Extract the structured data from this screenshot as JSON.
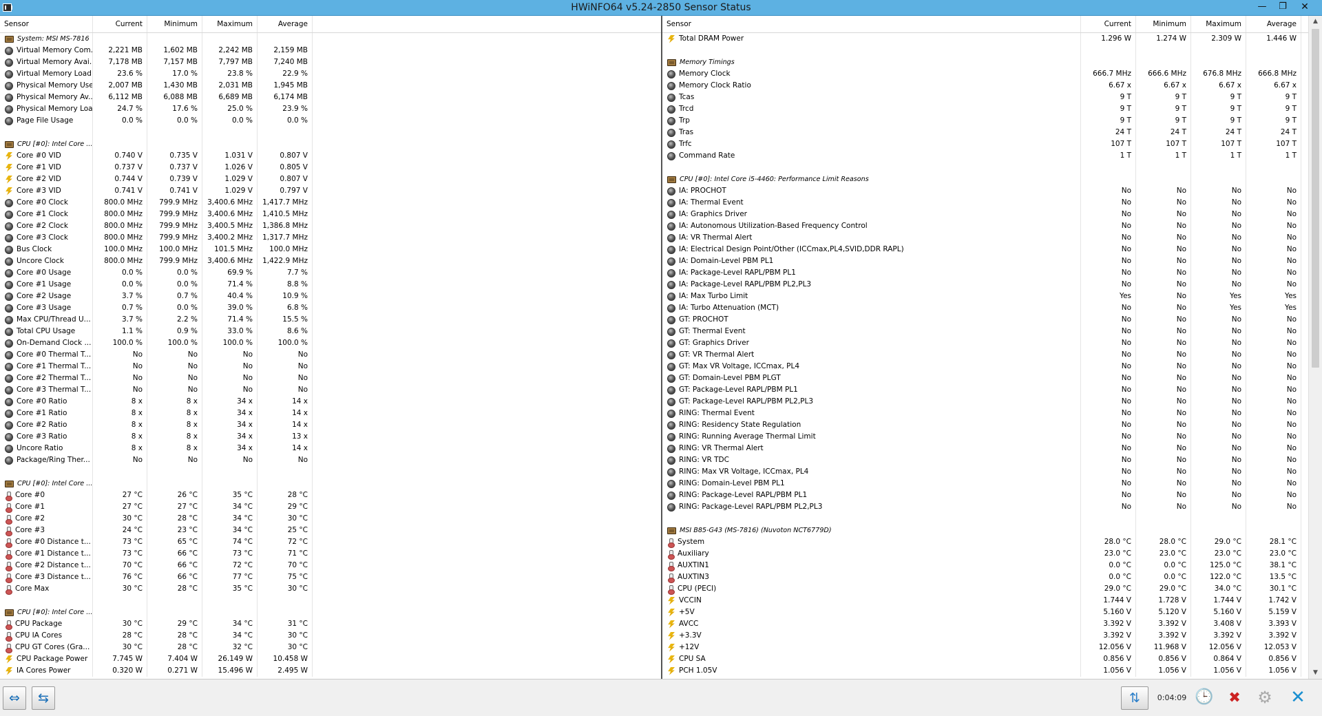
{
  "window": {
    "title": "HWiNFO64 v5.24-2850 Sensor Status",
    "min": "—",
    "max": "❐",
    "close": "✕"
  },
  "columns": {
    "sensor": "Sensor",
    "current": "Current",
    "minimum": "Minimum",
    "maximum": "Maximum",
    "average": "Average"
  },
  "left": [
    {
      "g": "chip",
      "n": "System: MSI MS-7816"
    },
    {
      "i": "circ",
      "n": "Virtual Memory Com...",
      "v": [
        "2,221 MB",
        "1,602 MB",
        "2,242 MB",
        "2,159 MB"
      ]
    },
    {
      "i": "circ",
      "n": "Virtual Memory Avai...",
      "v": [
        "7,178 MB",
        "7,157 MB",
        "7,797 MB",
        "7,240 MB"
      ]
    },
    {
      "i": "circ",
      "n": "Virtual Memory Load",
      "v": [
        "23.6 %",
        "17.0 %",
        "23.8 %",
        "22.9 %"
      ]
    },
    {
      "i": "circ",
      "n": "Physical Memory Used",
      "v": [
        "2,007 MB",
        "1,430 MB",
        "2,031 MB",
        "1,945 MB"
      ]
    },
    {
      "i": "circ",
      "n": "Physical Memory Av...",
      "v": [
        "6,112 MB",
        "6,088 MB",
        "6,689 MB",
        "6,174 MB"
      ]
    },
    {
      "i": "circ",
      "n": "Physical Memory Load",
      "v": [
        "24.7 %",
        "17.6 %",
        "25.0 %",
        "23.9 %"
      ]
    },
    {
      "i": "circ",
      "n": "Page File Usage",
      "v": [
        "0.0 %",
        "0.0 %",
        "0.0 %",
        "0.0 %"
      ]
    },
    {
      "gap": true
    },
    {
      "g": "chip",
      "n": "CPU [#0]: Intel Core ..."
    },
    {
      "i": "volt",
      "n": "Core #0 VID",
      "v": [
        "0.740 V",
        "0.735 V",
        "1.031 V",
        "0.807 V"
      ]
    },
    {
      "i": "volt",
      "n": "Core #1 VID",
      "v": [
        "0.737 V",
        "0.737 V",
        "1.026 V",
        "0.805 V"
      ]
    },
    {
      "i": "volt",
      "n": "Core #2 VID",
      "v": [
        "0.744 V",
        "0.739 V",
        "1.029 V",
        "0.807 V"
      ]
    },
    {
      "i": "volt",
      "n": "Core #3 VID",
      "v": [
        "0.741 V",
        "0.741 V",
        "1.029 V",
        "0.797 V"
      ]
    },
    {
      "i": "circ",
      "n": "Core #0 Clock",
      "v": [
        "800.0 MHz",
        "799.9 MHz",
        "3,400.6 MHz",
        "1,417.7 MHz"
      ]
    },
    {
      "i": "circ",
      "n": "Core #1 Clock",
      "v": [
        "800.0 MHz",
        "799.9 MHz",
        "3,400.6 MHz",
        "1,410.5 MHz"
      ]
    },
    {
      "i": "circ",
      "n": "Core #2 Clock",
      "v": [
        "800.0 MHz",
        "799.9 MHz",
        "3,400.5 MHz",
        "1,386.8 MHz"
      ]
    },
    {
      "i": "circ",
      "n": "Core #3 Clock",
      "v": [
        "800.0 MHz",
        "799.9 MHz",
        "3,400.2 MHz",
        "1,317.7 MHz"
      ]
    },
    {
      "i": "circ",
      "n": "Bus Clock",
      "v": [
        "100.0 MHz",
        "100.0 MHz",
        "101.5 MHz",
        "100.0 MHz"
      ]
    },
    {
      "i": "circ",
      "n": "Uncore Clock",
      "v": [
        "800.0 MHz",
        "799.9 MHz",
        "3,400.6 MHz",
        "1,422.9 MHz"
      ]
    },
    {
      "i": "circ",
      "n": "Core #0 Usage",
      "v": [
        "0.0 %",
        "0.0 %",
        "69.9 %",
        "7.7 %"
      ]
    },
    {
      "i": "circ",
      "n": "Core #1 Usage",
      "v": [
        "0.0 %",
        "0.0 %",
        "71.4 %",
        "8.8 %"
      ]
    },
    {
      "i": "circ",
      "n": "Core #2 Usage",
      "v": [
        "3.7 %",
        "0.7 %",
        "40.4 %",
        "10.9 %"
      ]
    },
    {
      "i": "circ",
      "n": "Core #3 Usage",
      "v": [
        "0.7 %",
        "0.0 %",
        "39.0 %",
        "6.8 %"
      ]
    },
    {
      "i": "circ",
      "n": "Max CPU/Thread U...",
      "v": [
        "3.7 %",
        "2.2 %",
        "71.4 %",
        "15.5 %"
      ]
    },
    {
      "i": "circ",
      "n": "Total CPU Usage",
      "v": [
        "1.1 %",
        "0.9 %",
        "33.0 %",
        "8.6 %"
      ]
    },
    {
      "i": "circ",
      "n": "On-Demand Clock ...",
      "v": [
        "100.0 %",
        "100.0 %",
        "100.0 %",
        "100.0 %"
      ]
    },
    {
      "i": "circ",
      "n": "Core #0 Thermal T...",
      "v": [
        "No",
        "No",
        "No",
        "No"
      ]
    },
    {
      "i": "circ",
      "n": "Core #1 Thermal T...",
      "v": [
        "No",
        "No",
        "No",
        "No"
      ]
    },
    {
      "i": "circ",
      "n": "Core #2 Thermal T...",
      "v": [
        "No",
        "No",
        "No",
        "No"
      ]
    },
    {
      "i": "circ",
      "n": "Core #3 Thermal T...",
      "v": [
        "No",
        "No",
        "No",
        "No"
      ]
    },
    {
      "i": "circ",
      "n": "Core #0 Ratio",
      "v": [
        "8 x",
        "8 x",
        "34 x",
        "14 x"
      ]
    },
    {
      "i": "circ",
      "n": "Core #1 Ratio",
      "v": [
        "8 x",
        "8 x",
        "34 x",
        "14 x"
      ]
    },
    {
      "i": "circ",
      "n": "Core #2 Ratio",
      "v": [
        "8 x",
        "8 x",
        "34 x",
        "14 x"
      ]
    },
    {
      "i": "circ",
      "n": "Core #3 Ratio",
      "v": [
        "8 x",
        "8 x",
        "34 x",
        "13 x"
      ]
    },
    {
      "i": "circ",
      "n": "Uncore Ratio",
      "v": [
        "8 x",
        "8 x",
        "34 x",
        "14 x"
      ]
    },
    {
      "i": "circ",
      "n": "Package/Ring Ther...",
      "v": [
        "No",
        "No",
        "No",
        "No"
      ]
    },
    {
      "gap": true
    },
    {
      "g": "chip",
      "n": "CPU [#0]: Intel Core ..."
    },
    {
      "i": "therm",
      "n": "Core #0",
      "v": [
        "27 °C",
        "26 °C",
        "35 °C",
        "28 °C"
      ]
    },
    {
      "i": "therm",
      "n": "Core #1",
      "v": [
        "27 °C",
        "27 °C",
        "34 °C",
        "29 °C"
      ]
    },
    {
      "i": "therm",
      "n": "Core #2",
      "v": [
        "30 °C",
        "28 °C",
        "34 °C",
        "30 °C"
      ]
    },
    {
      "i": "therm",
      "n": "Core #3",
      "v": [
        "24 °C",
        "23 °C",
        "34 °C",
        "25 °C"
      ]
    },
    {
      "i": "therm",
      "n": "Core #0 Distance t...",
      "v": [
        "73 °C",
        "65 °C",
        "74 °C",
        "72 °C"
      ]
    },
    {
      "i": "therm",
      "n": "Core #1 Distance t...",
      "v": [
        "73 °C",
        "66 °C",
        "73 °C",
        "71 °C"
      ]
    },
    {
      "i": "therm",
      "n": "Core #2 Distance t...",
      "v": [
        "70 °C",
        "66 °C",
        "72 °C",
        "70 °C"
      ]
    },
    {
      "i": "therm",
      "n": "Core #3 Distance t...",
      "v": [
        "76 °C",
        "66 °C",
        "77 °C",
        "75 °C"
      ]
    },
    {
      "i": "therm",
      "n": "Core Max",
      "v": [
        "30 °C",
        "28 °C",
        "35 °C",
        "30 °C"
      ]
    },
    {
      "gap": true
    },
    {
      "g": "chip",
      "n": "CPU [#0]: Intel Core ..."
    },
    {
      "i": "therm",
      "n": "CPU Package",
      "v": [
        "30 °C",
        "29 °C",
        "34 °C",
        "31 °C"
      ]
    },
    {
      "i": "therm",
      "n": "CPU IA Cores",
      "v": [
        "28 °C",
        "28 °C",
        "34 °C",
        "30 °C"
      ]
    },
    {
      "i": "therm",
      "n": "CPU GT Cores (Gra...",
      "v": [
        "30 °C",
        "28 °C",
        "32 °C",
        "30 °C"
      ]
    },
    {
      "i": "volt",
      "n": "CPU Package Power",
      "v": [
        "7.745 W",
        "7.404 W",
        "26.149 W",
        "10.458 W"
      ]
    },
    {
      "i": "volt",
      "n": "IA Cores Power",
      "v": [
        "0.320 W",
        "0.271 W",
        "15.496 W",
        "2.495 W"
      ]
    }
  ],
  "right": [
    {
      "i": "volt",
      "n": "Total DRAM Power",
      "v": [
        "1.296 W",
        "1.274 W",
        "2.309 W",
        "1.446 W"
      ]
    },
    {
      "gap": true
    },
    {
      "g": "chip",
      "n": "Memory Timings"
    },
    {
      "i": "circ",
      "n": "Memory Clock",
      "v": [
        "666.7 MHz",
        "666.6 MHz",
        "676.8 MHz",
        "666.8 MHz"
      ]
    },
    {
      "i": "circ",
      "n": "Memory Clock Ratio",
      "v": [
        "6.67 x",
        "6.67 x",
        "6.67 x",
        "6.67 x"
      ]
    },
    {
      "i": "circ",
      "n": "Tcas",
      "v": [
        "9 T",
        "9 T",
        "9 T",
        "9 T"
      ]
    },
    {
      "i": "circ",
      "n": "Trcd",
      "v": [
        "9 T",
        "9 T",
        "9 T",
        "9 T"
      ]
    },
    {
      "i": "circ",
      "n": "Trp",
      "v": [
        "9 T",
        "9 T",
        "9 T",
        "9 T"
      ]
    },
    {
      "i": "circ",
      "n": "Tras",
      "v": [
        "24 T",
        "24 T",
        "24 T",
        "24 T"
      ]
    },
    {
      "i": "circ",
      "n": "Trfc",
      "v": [
        "107 T",
        "107 T",
        "107 T",
        "107 T"
      ]
    },
    {
      "i": "circ",
      "n": "Command Rate",
      "v": [
        "1 T",
        "1 T",
        "1 T",
        "1 T"
      ]
    },
    {
      "gap": true
    },
    {
      "g": "chip",
      "n": "CPU [#0]: Intel Core i5-4460: Performance Limit Reasons"
    },
    {
      "i": "circ",
      "n": "IA: PROCHOT",
      "v": [
        "No",
        "No",
        "No",
        "No"
      ]
    },
    {
      "i": "circ",
      "n": "IA: Thermal Event",
      "v": [
        "No",
        "No",
        "No",
        "No"
      ]
    },
    {
      "i": "circ",
      "n": "IA: Graphics Driver",
      "v": [
        "No",
        "No",
        "No",
        "No"
      ]
    },
    {
      "i": "circ",
      "n": "IA: Autonomous Utilization-Based Frequency Control",
      "v": [
        "No",
        "No",
        "No",
        "No"
      ]
    },
    {
      "i": "circ",
      "n": "IA: VR Thermal Alert",
      "v": [
        "No",
        "No",
        "No",
        "No"
      ]
    },
    {
      "i": "circ",
      "n": "IA: Electrical Design Point/Other (ICCmax,PL4,SVID,DDR RAPL)",
      "v": [
        "No",
        "No",
        "No",
        "No"
      ]
    },
    {
      "i": "circ",
      "n": "IA: Domain-Level PBM PL1",
      "v": [
        "No",
        "No",
        "No",
        "No"
      ]
    },
    {
      "i": "circ",
      "n": "IA: Package-Level RAPL/PBM PL1",
      "v": [
        "No",
        "No",
        "No",
        "No"
      ]
    },
    {
      "i": "circ",
      "n": "IA: Package-Level RAPL/PBM PL2,PL3",
      "v": [
        "No",
        "No",
        "No",
        "No"
      ]
    },
    {
      "i": "circ",
      "n": "IA: Max Turbo Limit",
      "v": [
        "Yes",
        "No",
        "Yes",
        "Yes"
      ]
    },
    {
      "i": "circ",
      "n": "IA: Turbo Attenuation (MCT)",
      "v": [
        "No",
        "No",
        "Yes",
        "Yes"
      ]
    },
    {
      "i": "circ",
      "n": "GT: PROCHOT",
      "v": [
        "No",
        "No",
        "No",
        "No"
      ]
    },
    {
      "i": "circ",
      "n": "GT: Thermal Event",
      "v": [
        "No",
        "No",
        "No",
        "No"
      ]
    },
    {
      "i": "circ",
      "n": "GT: Graphics Driver",
      "v": [
        "No",
        "No",
        "No",
        "No"
      ]
    },
    {
      "i": "circ",
      "n": "GT: VR Thermal Alert",
      "v": [
        "No",
        "No",
        "No",
        "No"
      ]
    },
    {
      "i": "circ",
      "n": "GT: Max VR Voltage, ICCmax, PL4",
      "v": [
        "No",
        "No",
        "No",
        "No"
      ]
    },
    {
      "i": "circ",
      "n": "GT: Domain-Level PBM PLGT",
      "v": [
        "No",
        "No",
        "No",
        "No"
      ]
    },
    {
      "i": "circ",
      "n": "GT: Package-Level RAPL/PBM PL1",
      "v": [
        "No",
        "No",
        "No",
        "No"
      ]
    },
    {
      "i": "circ",
      "n": "GT: Package-Level RAPL/PBM PL2,PL3",
      "v": [
        "No",
        "No",
        "No",
        "No"
      ]
    },
    {
      "i": "circ",
      "n": "RING: Thermal Event",
      "v": [
        "No",
        "No",
        "No",
        "No"
      ]
    },
    {
      "i": "circ",
      "n": "RING: Residency State Regulation",
      "v": [
        "No",
        "No",
        "No",
        "No"
      ]
    },
    {
      "i": "circ",
      "n": "RING: Running Average Thermal Limit",
      "v": [
        "No",
        "No",
        "No",
        "No"
      ]
    },
    {
      "i": "circ",
      "n": "RING: VR Thermal Alert",
      "v": [
        "No",
        "No",
        "No",
        "No"
      ]
    },
    {
      "i": "circ",
      "n": "RING: VR TDC",
      "v": [
        "No",
        "No",
        "No",
        "No"
      ]
    },
    {
      "i": "circ",
      "n": "RING: Max VR Voltage, ICCmax, PL4",
      "v": [
        "No",
        "No",
        "No",
        "No"
      ]
    },
    {
      "i": "circ",
      "n": "RING: Domain-Level PBM PL1",
      "v": [
        "No",
        "No",
        "No",
        "No"
      ]
    },
    {
      "i": "circ",
      "n": "RING: Package-Level RAPL/PBM PL1",
      "v": [
        "No",
        "No",
        "No",
        "No"
      ]
    },
    {
      "i": "circ",
      "n": "RING: Package-Level RAPL/PBM PL2,PL3",
      "v": [
        "No",
        "No",
        "No",
        "No"
      ]
    },
    {
      "gap": true
    },
    {
      "g": "chip",
      "n": "MSI B85-G43 (MS-7816) (Nuvoton NCT6779D)"
    },
    {
      "i": "therm",
      "n": "System",
      "v": [
        "28.0 °C",
        "28.0 °C",
        "29.0 °C",
        "28.1 °C"
      ]
    },
    {
      "i": "therm",
      "n": "Auxiliary",
      "v": [
        "23.0 °C",
        "23.0 °C",
        "23.0 °C",
        "23.0 °C"
      ]
    },
    {
      "i": "therm",
      "n": "AUXTIN1",
      "v": [
        "0.0 °C",
        "0.0 °C",
        "125.0 °C",
        "38.1 °C"
      ]
    },
    {
      "i": "therm",
      "n": "AUXTIN3",
      "v": [
        "0.0 °C",
        "0.0 °C",
        "122.0 °C",
        "13.5 °C"
      ]
    },
    {
      "i": "therm",
      "n": "CPU (PECI)",
      "v": [
        "29.0 °C",
        "29.0 °C",
        "34.0 °C",
        "30.1 °C"
      ]
    },
    {
      "i": "volt",
      "n": "VCCIN",
      "v": [
        "1.744 V",
        "1.728 V",
        "1.744 V",
        "1.742 V"
      ]
    },
    {
      "i": "volt",
      "n": "+5V",
      "v": [
        "5.160 V",
        "5.120 V",
        "5.160 V",
        "5.159 V"
      ]
    },
    {
      "i": "volt",
      "n": "AVCC",
      "v": [
        "3.392 V",
        "3.392 V",
        "3.408 V",
        "3.393 V"
      ]
    },
    {
      "i": "volt",
      "n": "+3.3V",
      "v": [
        "3.392 V",
        "3.392 V",
        "3.392 V",
        "3.392 V"
      ]
    },
    {
      "i": "volt",
      "n": "+12V",
      "v": [
        "12.056 V",
        "11.968 V",
        "12.056 V",
        "12.053 V"
      ]
    },
    {
      "i": "volt",
      "n": "CPU SA",
      "v": [
        "0.856 V",
        "0.856 V",
        "0.864 V",
        "0.856 V"
      ]
    },
    {
      "i": "volt",
      "n": "PCH 1.05V",
      "v": [
        "1.056 V",
        "1.056 V",
        "1.056 V",
        "1.056 V"
      ]
    }
  ],
  "toolbar": {
    "expand": "⇔",
    "collapse": "⇆",
    "network": "⇅",
    "timer": "0:04:09",
    "clock": "🕒",
    "reset": "✖",
    "settings": "⚙",
    "exit": "✕"
  },
  "scrollbar": {
    "up": "▲",
    "down": "▼"
  },
  "icons": {
    "circ": "sensor-generic-icon",
    "volt": "voltage-bolt-icon",
    "therm": "thermometer-icon",
    "chip": "chip-group-icon"
  }
}
